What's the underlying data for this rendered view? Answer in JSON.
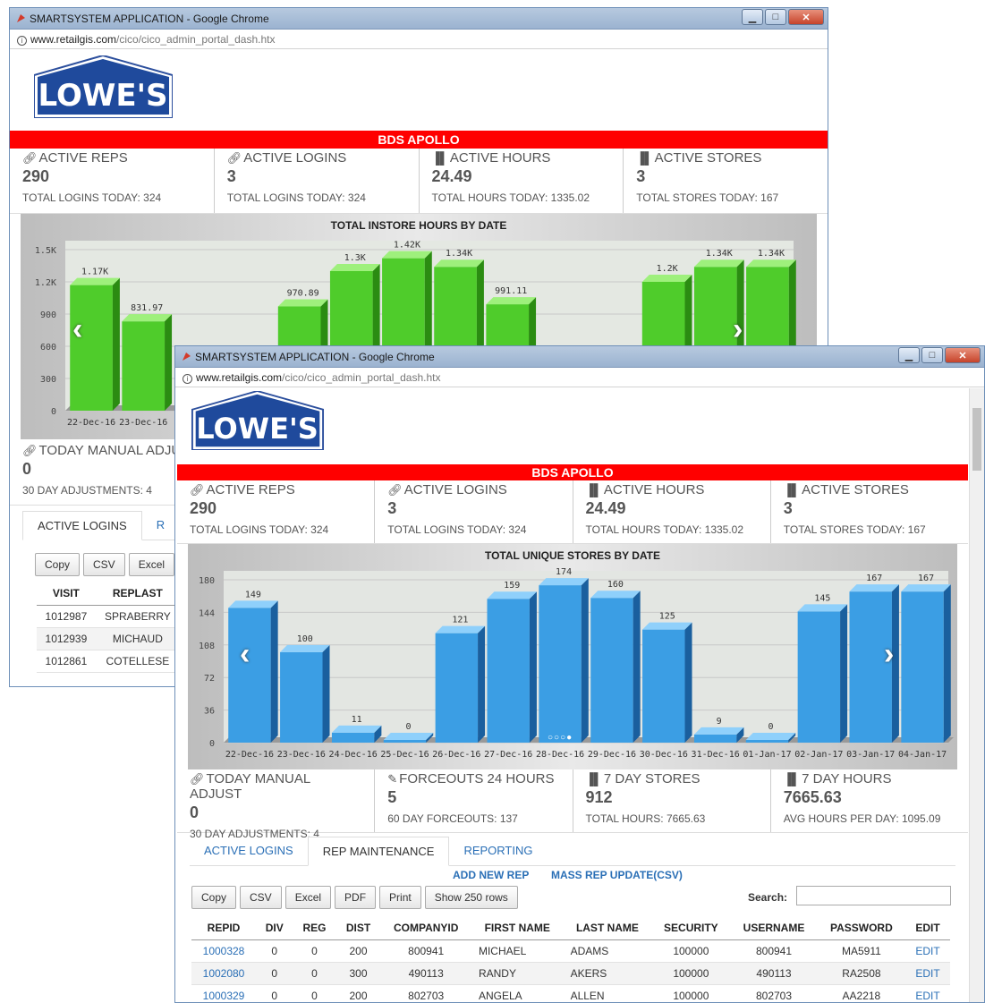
{
  "back_window": {
    "title": "SMARTSYSTEM APPLICATION - Google Chrome",
    "url_host": "www.retailgis.com",
    "url_path": "/cico/cico_admin_portal_dash.htx",
    "banner": "BDS APOLLO",
    "stats": [
      {
        "label": "ACTIVE REPS",
        "value": "290",
        "sub": "TOTAL LOGINS TODAY: 324",
        "icon": "link-icon"
      },
      {
        "label": "ACTIVE LOGINS",
        "value": "3",
        "sub": "TOTAL LOGINS TODAY: 324",
        "icon": "link-icon"
      },
      {
        "label": "ACTIVE HOURS",
        "value": "24.49",
        "sub": "TOTAL HOURS TODAY: 1335.02",
        "icon": "bar-chart-icon"
      },
      {
        "label": "ACTIVE STORES",
        "value": "3",
        "sub": "TOTAL STORES TODAY: 167",
        "icon": "bar-chart-icon"
      }
    ],
    "lower_stat": {
      "label": "TODAY MANUAL ADJU",
      "value": "0",
      "sub": "30 DAY ADJUSTMENTS: 4"
    },
    "tabs": [
      {
        "label": "ACTIVE LOGINS"
      },
      {
        "label": "R"
      }
    ],
    "buttons": {
      "copy": "Copy",
      "csv": "CSV",
      "excel": "Excel"
    },
    "table": {
      "headers": [
        "VISIT",
        "REPLAST"
      ],
      "rows": [
        [
          "1012987",
          "SPRABERRY"
        ],
        [
          "1012939",
          "MICHAUD"
        ],
        [
          "1012861",
          "COTELLESE"
        ]
      ]
    }
  },
  "front_window": {
    "title": "SMARTSYSTEM APPLICATION - Google Chrome",
    "url_host": "www.retailgis.com",
    "url_path": "/cico/cico_admin_portal_dash.htx",
    "banner": "BDS APOLLO",
    "stats": [
      {
        "label": "ACTIVE REPS",
        "value": "290",
        "sub": "TOTAL LOGINS TODAY: 324"
      },
      {
        "label": "ACTIVE LOGINS",
        "value": "3",
        "sub": "TOTAL LOGINS TODAY: 324"
      },
      {
        "label": "ACTIVE HOURS",
        "value": "24.49",
        "sub": "TOTAL HOURS TODAY: 1335.02"
      },
      {
        "label": "ACTIVE STORES",
        "value": "3",
        "sub": "TOTAL STORES TODAY: 167"
      }
    ],
    "stats2": [
      {
        "label": "TODAY MANUAL ADJUST",
        "value": "0",
        "sub": "30 DAY ADJUSTMENTS: 4"
      },
      {
        "label": "FORCEOUTS 24 HOURS",
        "value": "5",
        "sub": "60 DAY FORCEOUTS: 137"
      },
      {
        "label": "7 DAY STORES",
        "value": "912",
        "sub": "TOTAL HOURS: 7665.63"
      },
      {
        "label": "7 DAY HOURS",
        "value": "7665.63",
        "sub": "AVG HOURS PER DAY: 1095.09"
      }
    ],
    "tabs": [
      {
        "label": "ACTIVE LOGINS"
      },
      {
        "label": "REP MAINTENANCE"
      },
      {
        "label": "REPORTING"
      }
    ],
    "actions": {
      "add_new_rep": "ADD NEW REP",
      "mass_update": "MASS REP UPDATE(CSV)"
    },
    "buttons": {
      "copy": "Copy",
      "csv": "CSV",
      "excel": "Excel",
      "pdf": "PDF",
      "print": "Print",
      "show": "Show 250 rows"
    },
    "search_label": "Search:",
    "table": {
      "headers": [
        "REPID",
        "DIV",
        "REG",
        "DIST",
        "COMPANYID",
        "FIRST NAME",
        "LAST NAME",
        "SECURITY",
        "USERNAME",
        "PASSWORD",
        "EDIT"
      ],
      "rows": [
        [
          "1000328",
          "0",
          "0",
          "200",
          "800941",
          "MICHAEL",
          "ADAMS",
          "100000",
          "800941",
          "MA5911",
          "EDIT"
        ],
        [
          "1002080",
          "0",
          "0",
          "300",
          "490113",
          "RANDY",
          "AKERS",
          "100000",
          "490113",
          "RA2508",
          "EDIT"
        ],
        [
          "1000329",
          "0",
          "0",
          "200",
          "802703",
          "ANGELA",
          "ALLEN",
          "100000",
          "802703",
          "AA2218",
          "EDIT"
        ]
      ]
    }
  },
  "chart_data": [
    {
      "type": "bar",
      "title": "TOTAL INSTORE HOURS BY DATE",
      "color": "#44c221",
      "yticks": [
        "0",
        "300",
        "600",
        "900",
        "1.2K",
        "1.5K"
      ],
      "ylim": [
        0,
        1500
      ],
      "categories": [
        "22-Dec-16",
        "23-Dec-16",
        "24-Dec-16",
        "25-Dec-16",
        "26-Dec-16",
        "27-Dec-16",
        "28-Dec-16",
        "29-Dec-16",
        "30-Dec-16",
        "31-Dec-16",
        "01-Jan-17",
        "02-Jan-17",
        "03-Jan-17",
        "04-Jan-17"
      ],
      "visible_xlabels": [
        "22-Dec-16",
        "23-Dec-16"
      ],
      "values": [
        1170,
        831.97,
        null,
        null,
        970.89,
        1300,
        1420,
        1340,
        991.11,
        null,
        null,
        1200,
        1340,
        1340
      ],
      "labels": [
        "1.17K",
        "831.97",
        "",
        "",
        "970.89",
        "1.3K",
        "1.42K",
        "1.34K",
        "991.11",
        "",
        "",
        "1.2K",
        "1.34K",
        "1.34K"
      ]
    },
    {
      "type": "bar",
      "title": "TOTAL UNIQUE STORES BY DATE",
      "color": "#3e9ee0",
      "yticks": [
        "0",
        "36",
        "72",
        "108",
        "144",
        "180"
      ],
      "ylim": [
        0,
        180
      ],
      "categories": [
        "22-Dec-16",
        "23-Dec-16",
        "24-Dec-16",
        "25-Dec-16",
        "26-Dec-16",
        "27-Dec-16",
        "28-Dec-16",
        "29-Dec-16",
        "30-Dec-16",
        "31-Dec-16",
        "01-Jan-17",
        "02-Jan-17",
        "03-Jan-17",
        "04-Jan-17"
      ],
      "values": [
        149,
        100,
        11,
        0,
        121,
        159,
        174,
        160,
        125,
        9,
        0,
        145,
        167,
        167
      ],
      "labels": [
        "149",
        "100",
        "11",
        "0",
        "121",
        "159",
        "174",
        "160",
        "125",
        "9",
        "0",
        "145",
        "167",
        "167"
      ]
    }
  ]
}
